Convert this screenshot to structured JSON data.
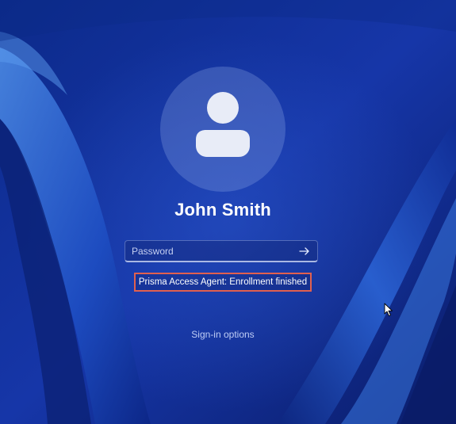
{
  "lock_screen": {
    "user_name": "John Smith",
    "password": {
      "placeholder": "Password",
      "value": ""
    },
    "submit_icon": "arrow-right-icon",
    "status_message": "Prisma Access Agent: Enrollment finished",
    "signin_options_label": "Sign-in options",
    "avatar_icon": "user-silhouette-icon"
  },
  "colors": {
    "background_dark": "#0a1f6e",
    "background_mid": "#1a3fb5",
    "ribbon_light": "#3d7be0",
    "highlight_box": "#e0604f",
    "text": "#ffffff"
  }
}
